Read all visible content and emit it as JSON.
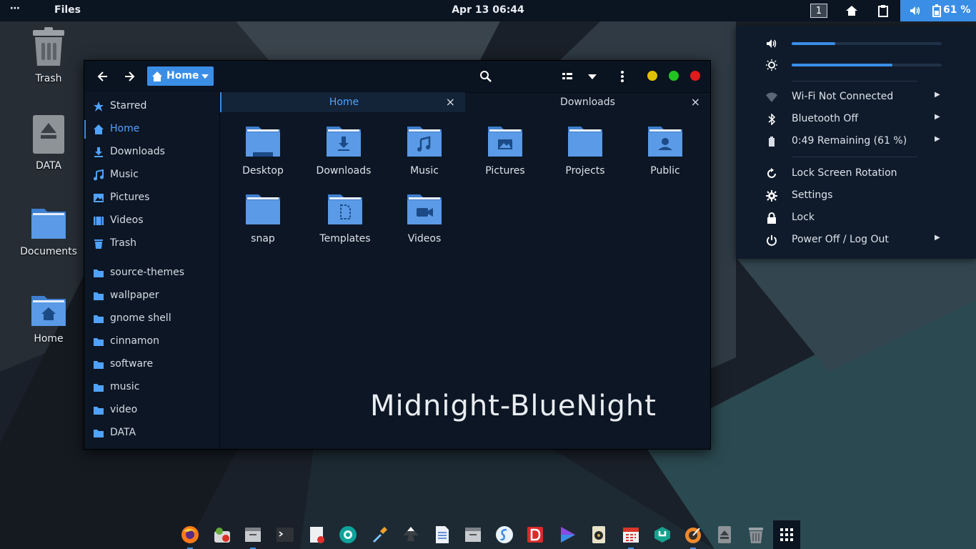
{
  "topbar": {
    "activities": "⋯",
    "app_name": "Files",
    "clock": "Apr 13  06:44",
    "workspace": "1",
    "battery_percent": "61 %"
  },
  "desktop_icons": [
    {
      "label": "Trash",
      "icon": "trash-icon"
    },
    {
      "label": "DATA",
      "icon": "drive-icon"
    },
    {
      "label": "Documents",
      "icon": "folder-icon"
    },
    {
      "label": "Home",
      "icon": "home-folder-icon"
    }
  ],
  "window": {
    "path_button": "Home",
    "sidebar": [
      {
        "label": "Starred",
        "icon": "star-icon"
      },
      {
        "label": "Home",
        "icon": "home-icon",
        "active": true
      },
      {
        "label": "Downloads",
        "icon": "download-icon"
      },
      {
        "label": "Music",
        "icon": "music-icon"
      },
      {
        "label": "Pictures",
        "icon": "picture-icon"
      },
      {
        "label": "Videos",
        "icon": "video-icon"
      },
      {
        "label": "Trash",
        "icon": "trash-icon"
      },
      {
        "label": "source-themes",
        "icon": "folder-icon"
      },
      {
        "label": "wallpaper",
        "icon": "folder-icon"
      },
      {
        "label": "gnome shell",
        "icon": "folder-icon"
      },
      {
        "label": "cinnamon",
        "icon": "folder-icon"
      },
      {
        "label": "software",
        "icon": "folder-icon"
      },
      {
        "label": "music",
        "icon": "folder-icon"
      },
      {
        "label": "video",
        "icon": "folder-icon"
      },
      {
        "label": "DATA",
        "icon": "folder-icon"
      }
    ],
    "tabs": [
      {
        "label": "Home",
        "active": true
      },
      {
        "label": "Downloads",
        "active": false
      }
    ],
    "folders": [
      {
        "label": "Desktop",
        "icon": "desktop-folder-icon"
      },
      {
        "label": "Downloads",
        "icon": "download-folder-icon"
      },
      {
        "label": "Music",
        "icon": "music-folder-icon"
      },
      {
        "label": "Pictures",
        "icon": "pictures-folder-icon"
      },
      {
        "label": "Projects",
        "icon": "folder-icon"
      },
      {
        "label": "Public",
        "icon": "public-folder-icon"
      },
      {
        "label": "snap",
        "icon": "folder-icon"
      },
      {
        "label": "Templates",
        "icon": "templates-folder-icon"
      },
      {
        "label": "Videos",
        "icon": "videos-folder-icon"
      }
    ],
    "brand_text": "Midnight-BlueNight"
  },
  "system_menu": {
    "volume_level": 0.29,
    "brightness_level": 0.67,
    "items": [
      {
        "label": "Wi-Fi Not Connected",
        "icon": "wifi-icon",
        "arrow": true
      },
      {
        "label": "Bluetooth Off",
        "icon": "bluetooth-icon",
        "arrow": true
      },
      {
        "label": "0:49 Remaining (61 %)",
        "icon": "battery-icon",
        "arrow": true
      },
      {
        "label": "Lock Screen Rotation",
        "icon": "rotation-icon",
        "arrow": false
      },
      {
        "label": "Settings",
        "icon": "gear-icon",
        "arrow": false
      },
      {
        "label": "Lock",
        "icon": "lock-icon",
        "arrow": false
      },
      {
        "label": "Power Off / Log Out",
        "icon": "power-icon",
        "arrow": true
      }
    ]
  },
  "dock": [
    {
      "name": "firefox-icon",
      "running": true
    },
    {
      "name": "software-icon",
      "running": false
    },
    {
      "name": "files-icon",
      "running": true
    },
    {
      "name": "terminal-icon",
      "running": false
    },
    {
      "name": "text-editor-icon",
      "running": false
    },
    {
      "name": "camera-icon",
      "running": false
    },
    {
      "name": "color-picker-icon",
      "running": false
    },
    {
      "name": "inkscape-icon",
      "running": false
    },
    {
      "name": "document-icon",
      "running": false
    },
    {
      "name": "files-alt-icon",
      "running": false
    },
    {
      "name": "simplenote-icon",
      "running": false
    },
    {
      "name": "d-app-icon",
      "running": false
    },
    {
      "name": "play-icon",
      "running": false
    },
    {
      "name": "speaker-icon",
      "running": false
    },
    {
      "name": "calendar-icon",
      "running": true
    },
    {
      "name": "tools-icon",
      "running": false
    },
    {
      "name": "disk-usage-icon",
      "running": true
    },
    {
      "name": "eject-icon",
      "running": false
    },
    {
      "name": "trash-icon",
      "running": false
    }
  ],
  "colors": {
    "accent": "#3a8ee6",
    "panel": "#0b1421",
    "window": "#0c1624"
  }
}
